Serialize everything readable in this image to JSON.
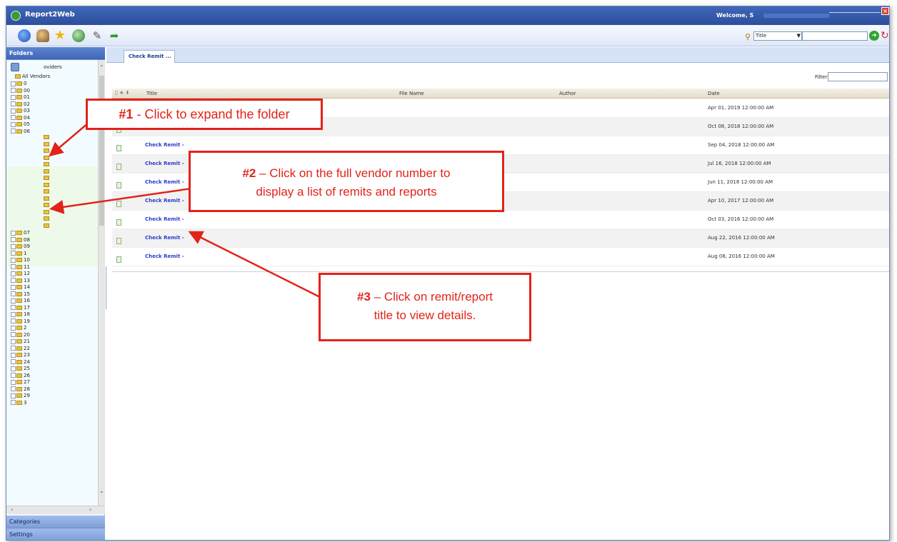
{
  "app": {
    "title": "Report2Web",
    "welcome": "Welcome, S"
  },
  "toolbar": {
    "search_field_value": "Title",
    "search_icon": "search-icon",
    "go_icon": "go-icon",
    "refresh_icon": "refresh-icon"
  },
  "left_panel": {
    "folders_label": "Folders",
    "categories_label": "Categories",
    "settings_label": "Settings",
    "root_label": "oviders",
    "all_vendors_label": "All Vendors",
    "folders_before": [
      "0",
      "00",
      "01",
      "02",
      "03",
      "04",
      "05"
    ],
    "expanded_folder": "06",
    "folders_after": [
      "07",
      "08",
      "09",
      "1",
      "10",
      "11",
      "12",
      "13",
      "14",
      "15",
      "16",
      "17",
      "18",
      "19",
      "2",
      "20",
      "21",
      "22",
      "23",
      "24",
      "25",
      "26",
      "27",
      "28",
      "29",
      "3"
    ]
  },
  "main": {
    "tab_label": "Check Remit ...",
    "filter_label": "Filter",
    "columns": {
      "title": "Title",
      "file_name": "File Name",
      "author": "Author",
      "date": "Date"
    },
    "rows": [
      {
        "title": "",
        "date": "Apr 01, 2019 12:00:00 AM"
      },
      {
        "title": "",
        "date": "Oct 08, 2018 12:00:00 AM"
      },
      {
        "title": "Check Remit -",
        "date": "Sep 04, 2018 12:00:00 AM"
      },
      {
        "title": "Check Remit -",
        "date": "Jul 16, 2018 12:00:00 AM"
      },
      {
        "title": "Check Remit -",
        "date": "Jun 11, 2018 12:00:00 AM"
      },
      {
        "title": "Check Remit -",
        "date": "Apr 10, 2017 12:00:00 AM"
      },
      {
        "title": "Check Remit -",
        "date": "Oct 03, 2016 12:00:00 AM"
      },
      {
        "title": "Check Remit -",
        "date": "Aug 22, 2016 12:00:00 AM"
      },
      {
        "title": "Check Remit -",
        "date": "Aug 08, 2016 12:00:00 AM"
      }
    ]
  },
  "callouts": {
    "c1_num": "#1",
    "c1_text": " - Click to expand the folder",
    "c2_num": "#2",
    "c2_text1": " – Click on the full vendor number to",
    "c2_text2": "display a list of remits and reports",
    "c3_num": "#3",
    "c3_text1": " – Click on remit/report",
    "c3_text2": "title to view details."
  },
  "colors": {
    "accent": "#3f66b8",
    "callout": "#e2231a",
    "link": "#2a3ccc"
  }
}
